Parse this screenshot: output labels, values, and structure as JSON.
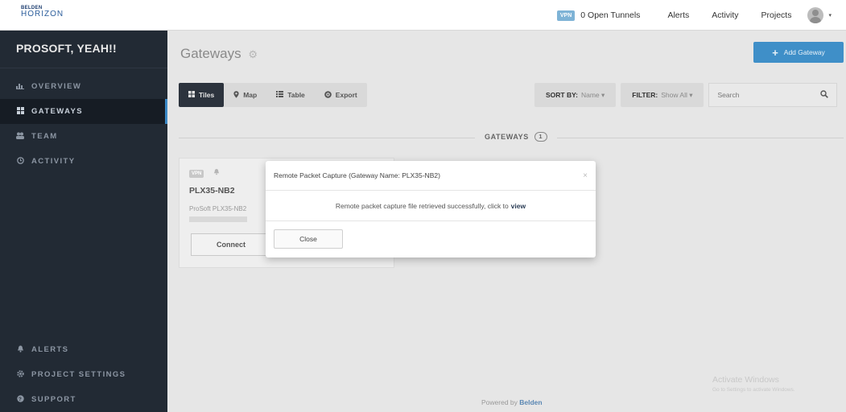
{
  "header": {
    "logo_small": "BELDEN",
    "logo_main": "HORIZON",
    "vpn_badge": "VPN",
    "open_tunnels": "0 Open Tunnels",
    "alerts": "Alerts",
    "activity": "Activity",
    "projects": "Projects",
    "caret": "▾"
  },
  "sidebar": {
    "project_title": "PROSOFT, YEAH!!",
    "items": [
      {
        "label": "OVERVIEW",
        "icon": "chart-icon"
      },
      {
        "label": "GATEWAYS",
        "icon": "grid-icon"
      },
      {
        "label": "TEAM",
        "icon": "team-icon"
      },
      {
        "label": "ACTIVITY",
        "icon": "clock-icon"
      }
    ],
    "bottom_items": [
      {
        "label": "ALERTS",
        "icon": "bell-icon"
      },
      {
        "label": "PROJECT SETTINGS",
        "icon": "gear-icon"
      },
      {
        "label": "SUPPORT",
        "icon": "help-icon"
      }
    ]
  },
  "main": {
    "page_title": "Gateways",
    "add_gateway": "Add Gateway",
    "toolbar": {
      "tiles": "Tiles",
      "map": "Map",
      "table": "Table",
      "export": "Export"
    },
    "sort_label": "SORT BY:",
    "sort_value": "Name ▾",
    "filter_label": "FILTER:",
    "filter_value": "Show All ▾",
    "search_placeholder": "Search",
    "section_label": "GATEWAYS",
    "section_count": "1",
    "card": {
      "vpn": "VPN",
      "name": "PLX35-NB2",
      "model": "ProSoft PLX35-NB2",
      "connect": "Connect"
    },
    "powered_by_prefix": "Powered by",
    "powered_by_brand": "Belden",
    "watermark_title": "Activate Windows",
    "watermark_sub": "Go to Settings to activate Windows."
  },
  "modal": {
    "title": "Remote Packet Capture (Gateway Name: PLX35-NB2)",
    "close_x": "×",
    "message": "Remote packet capture file retrieved successfully, click to",
    "view_link": "view",
    "close_button": "Close"
  },
  "colors": {
    "accent": "#3f8fc8",
    "sidebar_bg": "#222a34",
    "active_indicator": "#3a88c5"
  }
}
